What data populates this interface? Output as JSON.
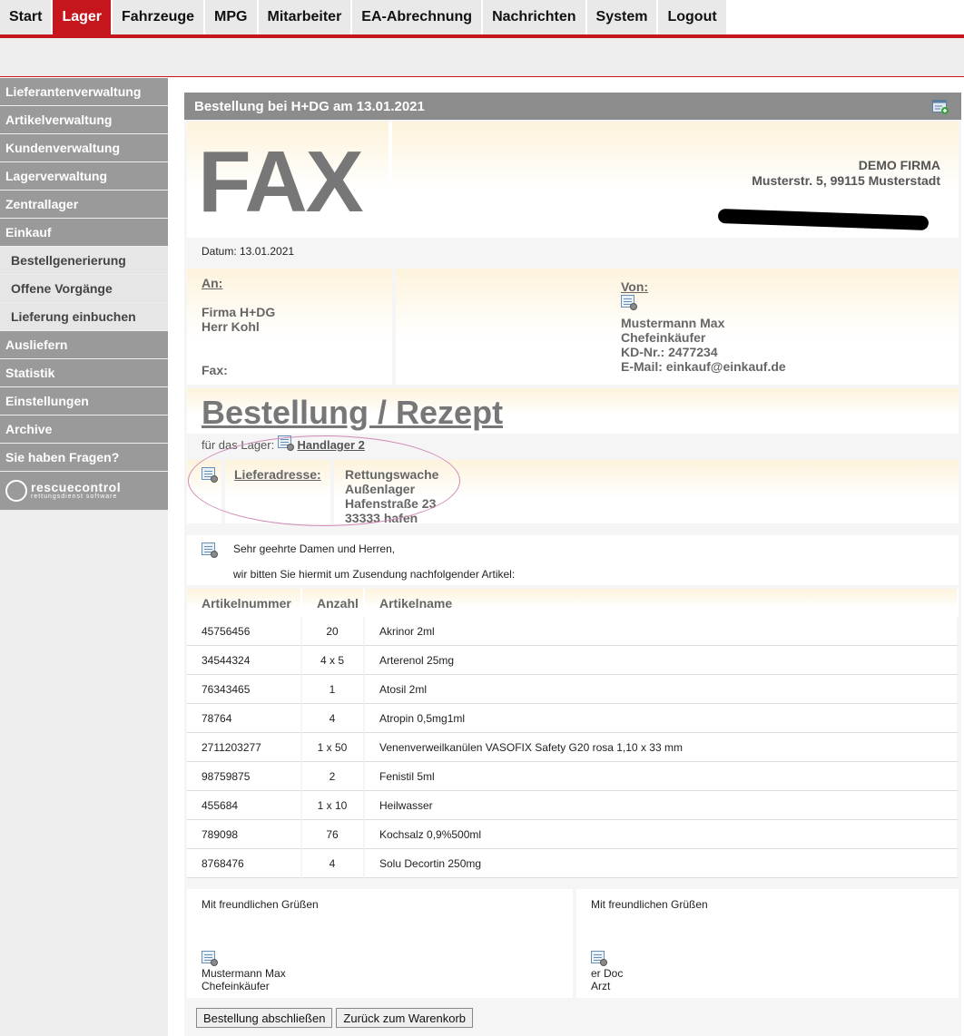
{
  "nav": {
    "tabs": [
      {
        "label": "Start"
      },
      {
        "label": "Lager"
      },
      {
        "label": "Fahrzeuge"
      },
      {
        "label": "MPG"
      },
      {
        "label": "Mitarbeiter"
      },
      {
        "label": "EA-Abrechnung"
      },
      {
        "label": "Nachrichten"
      },
      {
        "label": "System"
      },
      {
        "label": "Logout"
      }
    ],
    "active": "Lager"
  },
  "sidebar": {
    "items": [
      {
        "label": "Lieferantenverwaltung",
        "sub": false
      },
      {
        "label": "Artikelverwaltung",
        "sub": false
      },
      {
        "label": "Kundenverwaltung",
        "sub": false
      },
      {
        "label": "Lagerverwaltung",
        "sub": false
      },
      {
        "label": "Zentrallager",
        "sub": false
      },
      {
        "label": "Einkauf",
        "sub": false
      },
      {
        "label": "Bestellgenerierung",
        "sub": true
      },
      {
        "label": "Offene Vorgänge",
        "sub": true
      },
      {
        "label": "Lieferung einbuchen",
        "sub": true
      },
      {
        "label": "Ausliefern",
        "sub": false
      },
      {
        "label": "Statistik",
        "sub": false
      },
      {
        "label": "Einstellungen",
        "sub": false
      },
      {
        "label": "Archive",
        "sub": false
      },
      {
        "label": "Sie haben Fragen?",
        "sub": false
      }
    ],
    "logo": {
      "name": "rescuecontrol",
      "tagline": "rettungsdienst software"
    }
  },
  "panel": {
    "title": "Bestellung bei H+DG am 13.01.2021",
    "fax_label": "FAX",
    "firm_name": "DEMO FIRMA",
    "firm_address": "Musterstr. 5, 99115 Musterstadt",
    "datum": "Datum: 13.01.2021",
    "an": {
      "label": "An:",
      "line1": "Firma H+DG",
      "line2": "Herr Kohl",
      "fax": "Fax:"
    },
    "von": {
      "label": "Von:",
      "name": "Mustermann Max",
      "role": "Chefeinkäufer",
      "kd": "KD-Nr.: 2477234",
      "email": "E-Mail: einkauf@einkauf.de"
    },
    "heading": "Bestellung / Rezept",
    "lager_prefix": "für das Lager:",
    "lager_link": "Handlager 2",
    "lieferadresse": {
      "label": "Lieferadresse:",
      "lines": [
        "Rettungswache",
        "Außenlager",
        "Hafenstraße 23",
        "33333 hafen"
      ]
    },
    "greeting": "Sehr geehrte Damen und Herren,",
    "request": "wir bitten Sie hiermit um Zusendung nachfolgender Artikel:",
    "table": {
      "headers": [
        "Artikelnummer",
        "Anzahl",
        "Artikelname"
      ],
      "rows": [
        [
          "45756456",
          "20",
          "Akrinor 2ml"
        ],
        [
          "34544324",
          "4 x 5",
          "Arterenol 25mg"
        ],
        [
          "76343465",
          "1",
          "Atosil 2ml"
        ],
        [
          "78764",
          "4",
          "Atropin 0,5mg1ml"
        ],
        [
          "2711203277",
          "1 x 50",
          "Venenverweilkanülen VASOFIX Safety G20 rosa 1,10 x 33 mm"
        ],
        [
          "98759875",
          "2",
          "Fenistil 5ml"
        ],
        [
          "455684",
          "1 x 10",
          "Heilwasser"
        ],
        [
          "789098",
          "76",
          "Kochsalz 0,9%500ml"
        ],
        [
          "8768476",
          "4",
          "Solu Decortin 250mg"
        ]
      ]
    },
    "sign_left": {
      "greeting": "Mit freundlichen Grüßen",
      "name": "Mustermann Max",
      "role": "Chefeinkäufer"
    },
    "sign_right": {
      "greeting": "Mit freundlichen Grüßen",
      "name": "er Doc",
      "role": "Arzt"
    },
    "buttons": {
      "finish": "Bestellung abschließen",
      "back": "Zurück zum Warenkorb"
    }
  },
  "colors": {
    "brand_red": "#c4161c",
    "sidebar_gray": "#9a9a9a",
    "header_gray": "#8c8c8c"
  },
  "icons": [
    "document-gear-icon",
    "add-window-icon",
    "rescuecontrol-logo"
  ]
}
